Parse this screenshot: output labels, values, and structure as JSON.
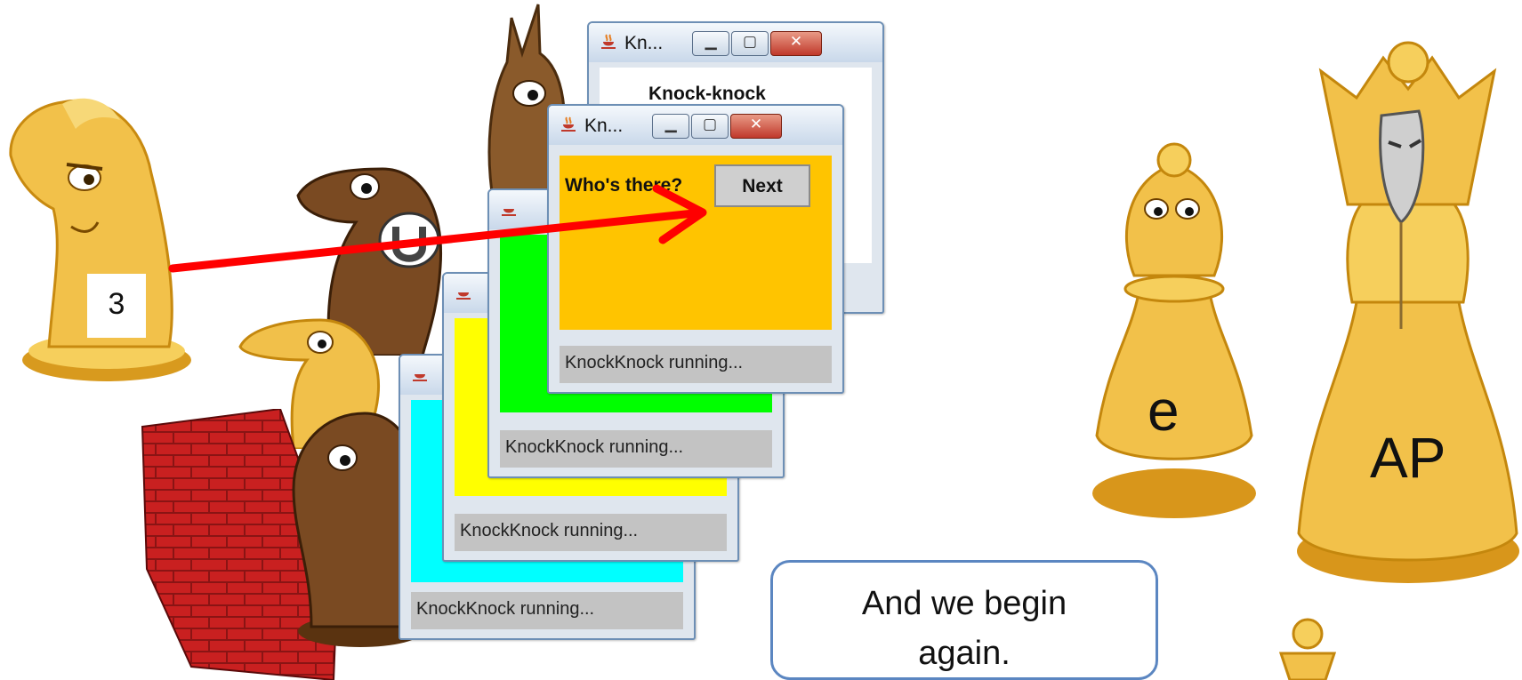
{
  "windows": [
    {
      "title": "Kn...",
      "heading_partial": "Knock-knock",
      "panel_color": "#ffffff"
    },
    {
      "title": "Kn...",
      "prompt": "Who's there?",
      "next_label": "Next",
      "status": "KnockKnock running...",
      "panel_color": "#ffc400"
    },
    {
      "status": "KnockKnock running...",
      "panel_color": "#00ff00"
    },
    {
      "status": "KnockKnock running...",
      "panel_color": "#ffff00"
    },
    {
      "status": "KnockKnock running...",
      "panel_color": "#00ffff"
    }
  ],
  "labels": {
    "knight_number": "3",
    "pawn_letter": "e",
    "queen_label": "AP"
  },
  "callout": {
    "line1": "And we begin",
    "line2": "again."
  },
  "icons": [
    "java-icon",
    "minimize-icon",
    "maximize-icon",
    "close-icon",
    "horseshoe-icon"
  ]
}
